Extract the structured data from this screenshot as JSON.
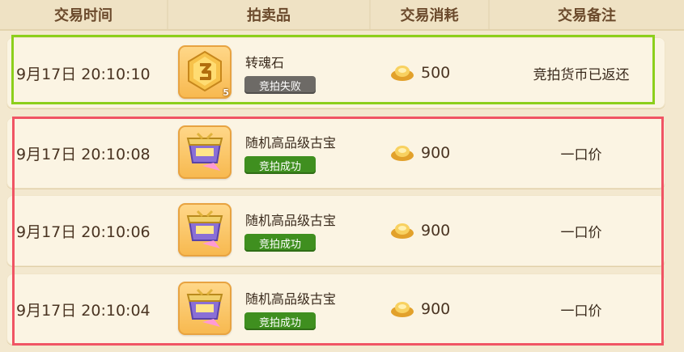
{
  "header": {
    "time": "交易时间",
    "item": "拍卖品",
    "cost": "交易消耗",
    "note": "交易备注"
  },
  "records": [
    {
      "time": "9月17日 20:10:10",
      "item_name": "转魂石",
      "item_icon": "soul-stone-icon",
      "quantity": "5",
      "status": "竞拍失败",
      "status_type": "fail",
      "amount": "500",
      "note": "竞拍货币已返还"
    },
    {
      "time": "9月17日 20:10:08",
      "item_name": "随机高品级古宝",
      "item_icon": "treasure-chest-icon",
      "status": "竞拍成功",
      "status_type": "success",
      "amount": "900",
      "note": "一口价"
    },
    {
      "time": "9月17日 20:10:06",
      "item_name": "随机高品级古宝",
      "item_icon": "treasure-chest-icon",
      "status": "竞拍成功",
      "status_type": "success",
      "amount": "900",
      "note": "一口价"
    },
    {
      "time": "9月17日 20:10:04",
      "item_name": "随机高品级古宝",
      "item_icon": "treasure-chest-icon",
      "status": "竞拍成功",
      "status_type": "success",
      "amount": "900",
      "note": "一口价"
    }
  ],
  "colors": {
    "highlight_green": "#8ccf1c",
    "highlight_red": "#f05464",
    "status_fail": "#6d6a66",
    "status_success": "#3f8f1f"
  }
}
